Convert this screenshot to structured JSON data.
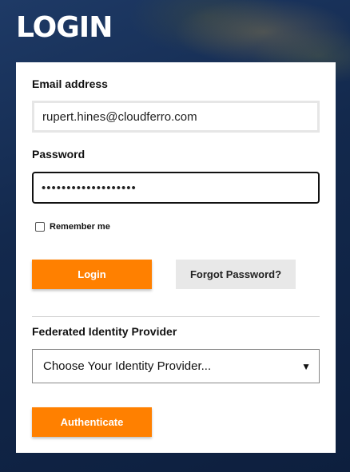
{
  "page": {
    "title": "LOGIN"
  },
  "form": {
    "email_label": "Email address",
    "email_value": "rupert.hines@cloudferro.com",
    "password_label": "Password",
    "password_value": "•••••••••••••••••••",
    "remember_label": "Remember me",
    "login_label": "Login",
    "forgot_label": "Forgot Password?",
    "federated_label": "Federated Identity Provider",
    "provider_selected": "Choose Your Identity Provider...",
    "authenticate_label": "Authenticate"
  },
  "colors": {
    "accent": "#ff8000",
    "secondary_button": "#e8e8e8"
  },
  "icons": {
    "select_chevron": "chevron-down-icon"
  }
}
